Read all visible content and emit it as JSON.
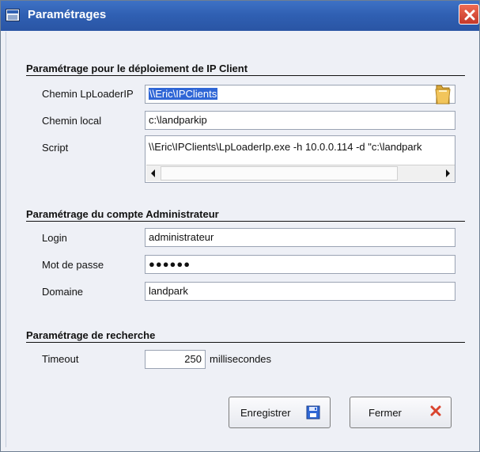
{
  "window": {
    "title": "Paramétrages"
  },
  "deployment": {
    "heading": "Paramétrage pour le déploiement de IP Client",
    "lploader_label": "Chemin LpLoaderIP",
    "lploader_value": "\\\\Eric\\IPClients",
    "local_label": "Chemin local",
    "local_value": "c:\\landparkip",
    "script_label": "Script",
    "script_value": "\\\\Eric\\IPClients\\LpLoaderIp.exe -h 10.0.0.114 -d \"c:\\landpark"
  },
  "admin": {
    "heading": "Paramétrage du compte Administrateur",
    "login_label": "Login",
    "login_value": "administrateur",
    "password_label": "Mot de passe",
    "password_value": "●●●●●●",
    "domain_label": "Domaine",
    "domain_value": "landpark"
  },
  "search": {
    "heading": "Paramétrage de recherche",
    "timeout_label": "Timeout",
    "timeout_value": "250",
    "timeout_unit": "millisecondes"
  },
  "buttons": {
    "save_label": "Enregistrer",
    "close_label": "Fermer"
  },
  "icons": {
    "app": "app-icon",
    "close": "close-icon",
    "folder": "folder-icon",
    "save": "floppy-disk-icon",
    "exit": "close-x-icon"
  },
  "colors": {
    "titlebar": "#2f5fb2",
    "selection": "#2f66d6",
    "close_button": "#d9442e"
  }
}
